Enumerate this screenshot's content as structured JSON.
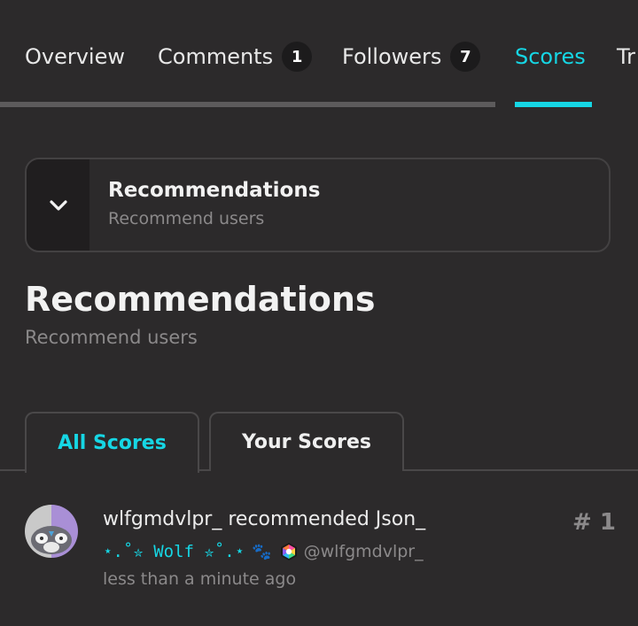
{
  "tabs": [
    {
      "label": "Overview",
      "count": null,
      "active": false
    },
    {
      "label": "Comments",
      "count": "1",
      "active": false
    },
    {
      "label": "Followers",
      "count": "7",
      "active": false
    },
    {
      "label": "Scores",
      "count": null,
      "active": true
    },
    {
      "label": "Tr",
      "count": null,
      "active": false
    }
  ],
  "accordion": {
    "title": "Recommendations",
    "subtitle": "Recommend users",
    "icon": "chevron-down-icon"
  },
  "section": {
    "title": "Recommendations",
    "subtitle": "Recommend users"
  },
  "score_tabs": {
    "all": "All Scores",
    "yours": "Your Scores",
    "selected": "All Scores"
  },
  "recommendations": [
    {
      "text": "wlfgmdvlpr_ recommended Json_",
      "display_name": "⋆.˚✮ Wolf ✮˚.⋆",
      "emoji": "🐾",
      "badge_icon": "hex-badge-icon",
      "handle": "@wlfgmdvlpr_",
      "time": "less than a minute ago",
      "rank": "# 1"
    }
  ],
  "colors": {
    "background": "#2c2a2b",
    "accent": "#16d6e4",
    "muted_text": "#8b898a",
    "panel_dark": "#201e1f"
  }
}
